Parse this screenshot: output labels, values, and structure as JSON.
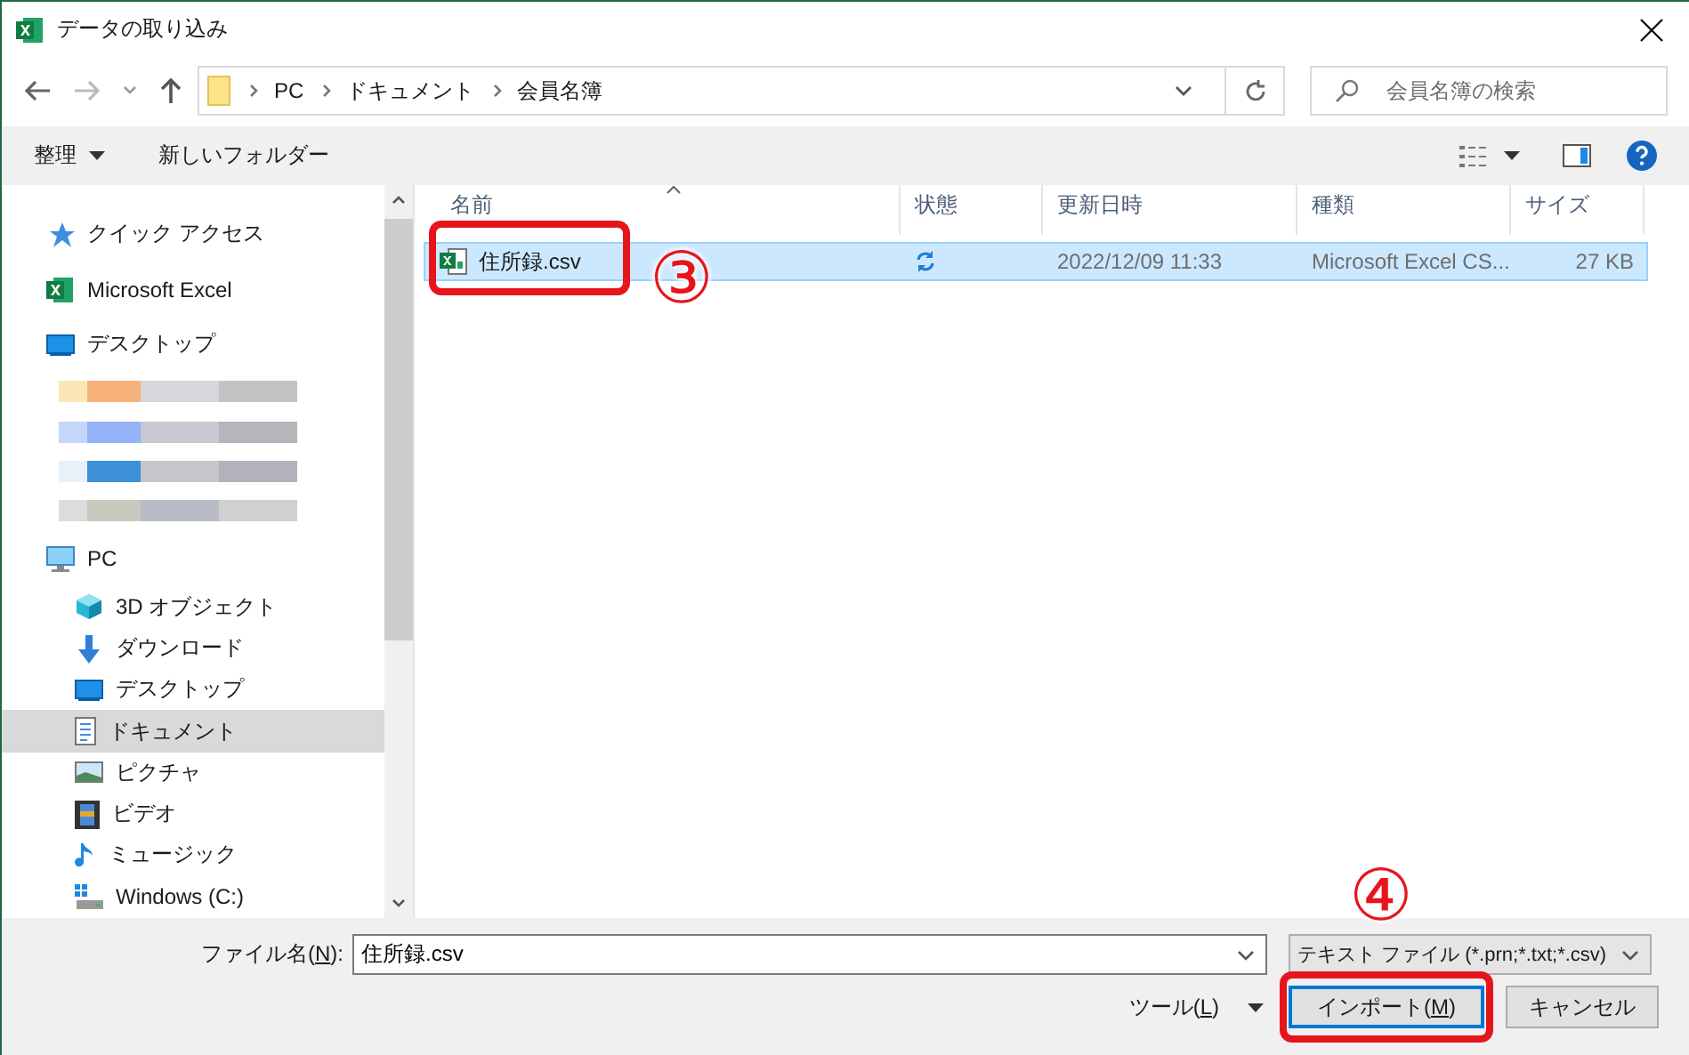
{
  "window": {
    "title": "データの取り込み"
  },
  "address": {
    "segments": [
      "PC",
      "ドキュメント",
      "会員名簿"
    ]
  },
  "search": {
    "placeholder": "会員名簿の検索"
  },
  "toolbar": {
    "organize": "整理",
    "new_folder": "新しいフォルダー"
  },
  "sidebar": {
    "items": [
      {
        "kind": "quick",
        "label": "クイック アクセス",
        "selected": false
      },
      {
        "kind": "excel",
        "label": "Microsoft Excel",
        "selected": false
      },
      {
        "kind": "desktop",
        "label": "デスクトップ",
        "selected": false,
        "children": [
          {
            "kind": "blurred",
            "selected": false
          },
          {
            "kind": "blurred",
            "selected": false
          },
          {
            "kind": "blurred",
            "selected": false
          },
          {
            "kind": "blurred",
            "selected": false
          }
        ]
      },
      {
        "kind": "pc",
        "label": "PC",
        "selected": false,
        "children": [
          {
            "kind": "cube",
            "label": "3D オブジェクト",
            "selected": false
          },
          {
            "kind": "download",
            "label": "ダウンロード",
            "selected": false
          },
          {
            "kind": "desktop",
            "label": "デスクトップ",
            "selected": false
          },
          {
            "kind": "document",
            "label": "ドキュメント",
            "selected": true
          },
          {
            "kind": "pictures",
            "label": "ピクチャ",
            "selected": false
          },
          {
            "kind": "video",
            "label": "ビデオ",
            "selected": false
          },
          {
            "kind": "music",
            "label": "ミュージック",
            "selected": false
          },
          {
            "kind": "drive",
            "label": "Windows (C:)",
            "selected": false
          }
        ]
      }
    ]
  },
  "table": {
    "columns": [
      "名前",
      "状態",
      "更新日時",
      "種類",
      "サイズ"
    ],
    "rows": [
      {
        "name": "住所録.csv",
        "syncing": true,
        "modified": "2022/12/09 11:33",
        "type": "Microsoft Excel CS...",
        "size": "27 KB",
        "selected": true,
        "step": "③"
      }
    ]
  },
  "footer": {
    "filename_label": {
      "before": "ファイル名(",
      "key": "N",
      "after": "):"
    },
    "filename": "住所録.csv",
    "filter": "テキスト ファイル (*.prn;*.txt;*.csv)",
    "tools": {
      "before": "ツール(",
      "key": "L",
      "after": ")"
    },
    "import": {
      "before": "インポート(",
      "key": "M",
      "after": ")",
      "step": "④"
    },
    "cancel": "キャンセル"
  }
}
